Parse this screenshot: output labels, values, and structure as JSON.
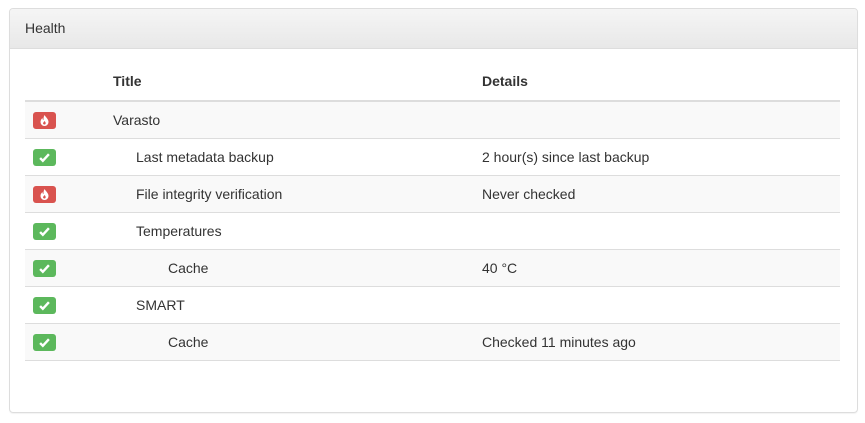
{
  "panel": {
    "title": "Health"
  },
  "table": {
    "headers": {
      "title": "Title",
      "details": "Details"
    },
    "rows": [
      {
        "status": "fail",
        "icon": "fire-icon",
        "title": "Varasto",
        "details": "",
        "level": 0
      },
      {
        "status": "ok",
        "icon": "check-icon",
        "title": "Last metadata backup",
        "details": "2 hour(s) since last backup",
        "level": 1
      },
      {
        "status": "fail",
        "icon": "fire-icon",
        "title": "File integrity verification",
        "details": "Never checked",
        "level": 1
      },
      {
        "status": "ok",
        "icon": "check-icon",
        "title": "Temperatures",
        "details": "",
        "level": 1
      },
      {
        "status": "ok",
        "icon": "check-icon",
        "title": "Cache",
        "details": "40 °C",
        "level": 2
      },
      {
        "status": "ok",
        "icon": "check-icon",
        "title": "SMART",
        "details": "",
        "level": 1
      },
      {
        "status": "ok",
        "icon": "check-icon",
        "title": "Cache",
        "details": "Checked 11 minutes ago",
        "level": 2
      }
    ]
  },
  "colors": {
    "fail": "#d9534f",
    "ok": "#5cb85c"
  }
}
